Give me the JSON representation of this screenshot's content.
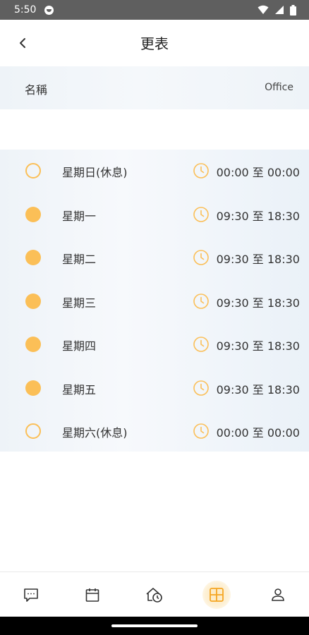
{
  "status_bar": {
    "time": "5:50"
  },
  "header": {
    "title": "更表"
  },
  "info": {
    "name_label": "名稱",
    "name_value": "Office"
  },
  "schedule": [
    {
      "day": "星期日(休息)",
      "active": false,
      "time": "00:00 至 00:00"
    },
    {
      "day": "星期一",
      "active": true,
      "time": "09:30 至 18:30"
    },
    {
      "day": "星期二",
      "active": true,
      "time": "09:30 至 18:30"
    },
    {
      "day": "星期三",
      "active": true,
      "time": "09:30 至 18:30"
    },
    {
      "day": "星期四",
      "active": true,
      "time": "09:30 至 18:30"
    },
    {
      "day": "星期五",
      "active": true,
      "time": "09:30 至 18:30"
    },
    {
      "day": "星期六(休息)",
      "active": false,
      "time": "00:00 至 00:00"
    }
  ],
  "bottom_nav": [
    {
      "icon": "chat-icon",
      "active": false
    },
    {
      "icon": "calendar-icon",
      "active": false
    },
    {
      "icon": "home-clock-icon",
      "active": false
    },
    {
      "icon": "grid-icon",
      "active": true
    },
    {
      "icon": "user-icon",
      "active": false
    }
  ],
  "colors": {
    "accent": "#fbbf57",
    "status_bar": "#5f5f5f"
  }
}
